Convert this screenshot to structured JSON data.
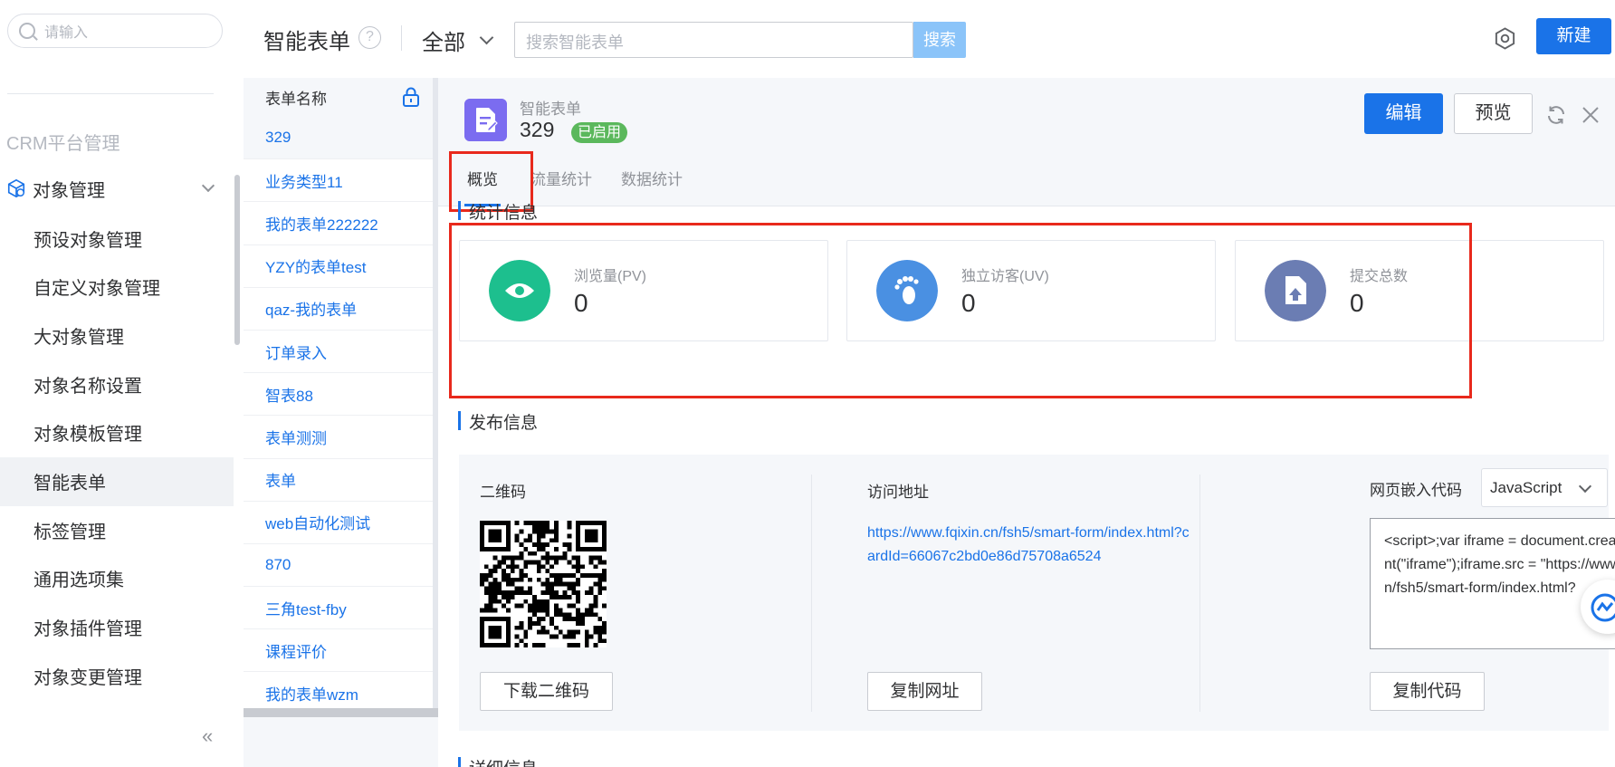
{
  "sidebar": {
    "search_placeholder": "请输入",
    "section_title": "CRM平台管理",
    "group_label": "对象管理",
    "items": [
      {
        "label": "预设对象管理",
        "active": false
      },
      {
        "label": "自定义对象管理",
        "active": false
      },
      {
        "label": "大对象管理",
        "active": false
      },
      {
        "label": "对象名称设置",
        "active": false
      },
      {
        "label": "对象模板管理",
        "active": false
      },
      {
        "label": "智能表单",
        "active": true
      },
      {
        "label": "标签管理",
        "active": false
      },
      {
        "label": "通用选项集",
        "active": false
      },
      {
        "label": "对象插件管理",
        "active": false
      },
      {
        "label": "对象变更管理",
        "active": false
      }
    ],
    "collapse_glyph": "«"
  },
  "topbar": {
    "title": "智能表单",
    "help_glyph": "?",
    "filter_label": "全部",
    "search_placeholder": "搜索智能表单",
    "search_button": "搜索",
    "new_button": "新建"
  },
  "form_list": {
    "header": "表单名称",
    "rows": [
      "329",
      "业务类型11",
      "我的表单222222",
      "YZY的表单test",
      "qaz-我的表单",
      "订单录入",
      "智表88",
      "表单测测",
      "表单",
      "web自动化测试",
      "870",
      "三角test-fby",
      "课程评价",
      "我的表单wzm"
    ]
  },
  "detail": {
    "label": "智能表单",
    "name": "329",
    "status": "已启用",
    "edit_button": "编辑",
    "preview_button": "预览",
    "tabs": [
      {
        "label": "概览",
        "active": true
      },
      {
        "label": "流量统计",
        "active": false
      },
      {
        "label": "数据统计",
        "active": false
      }
    ],
    "stats_title": "统计信息",
    "stats": [
      {
        "label": "浏览量(PV)",
        "value": "0",
        "color": "#1dbf8e",
        "icon": "eye-icon"
      },
      {
        "label": "独立访客(UV)",
        "value": "0",
        "color": "#4a90e2",
        "icon": "footprint-icon"
      },
      {
        "label": "提交总数",
        "value": "0",
        "color": "#6b7db3",
        "icon": "upload-file-icon"
      }
    ],
    "publish_title": "发布信息",
    "publish": {
      "qr_label": "二维码",
      "qr_button": "下载二维码",
      "url_label": "访问地址",
      "url": "https://www.fqixin.cn/fsh5/smart-form/index.html?cardId=66067c2bd0e86d75708a6524",
      "url_button": "复制网址",
      "embed_label": "网页嵌入代码",
      "embed_lang": "JavaScript",
      "embed_code": "<script>;var iframe = document.createElement(\"iframe\");iframe.src = \"https://www.fqixin.cn/fsh5/smart-form/index.html?",
      "embed_button": "复制代码"
    },
    "detail_title": "详细信息"
  },
  "colors": {
    "primary": "#1a73e8",
    "highlight_box": "#e8291c",
    "status_green": "#5bb85c"
  }
}
